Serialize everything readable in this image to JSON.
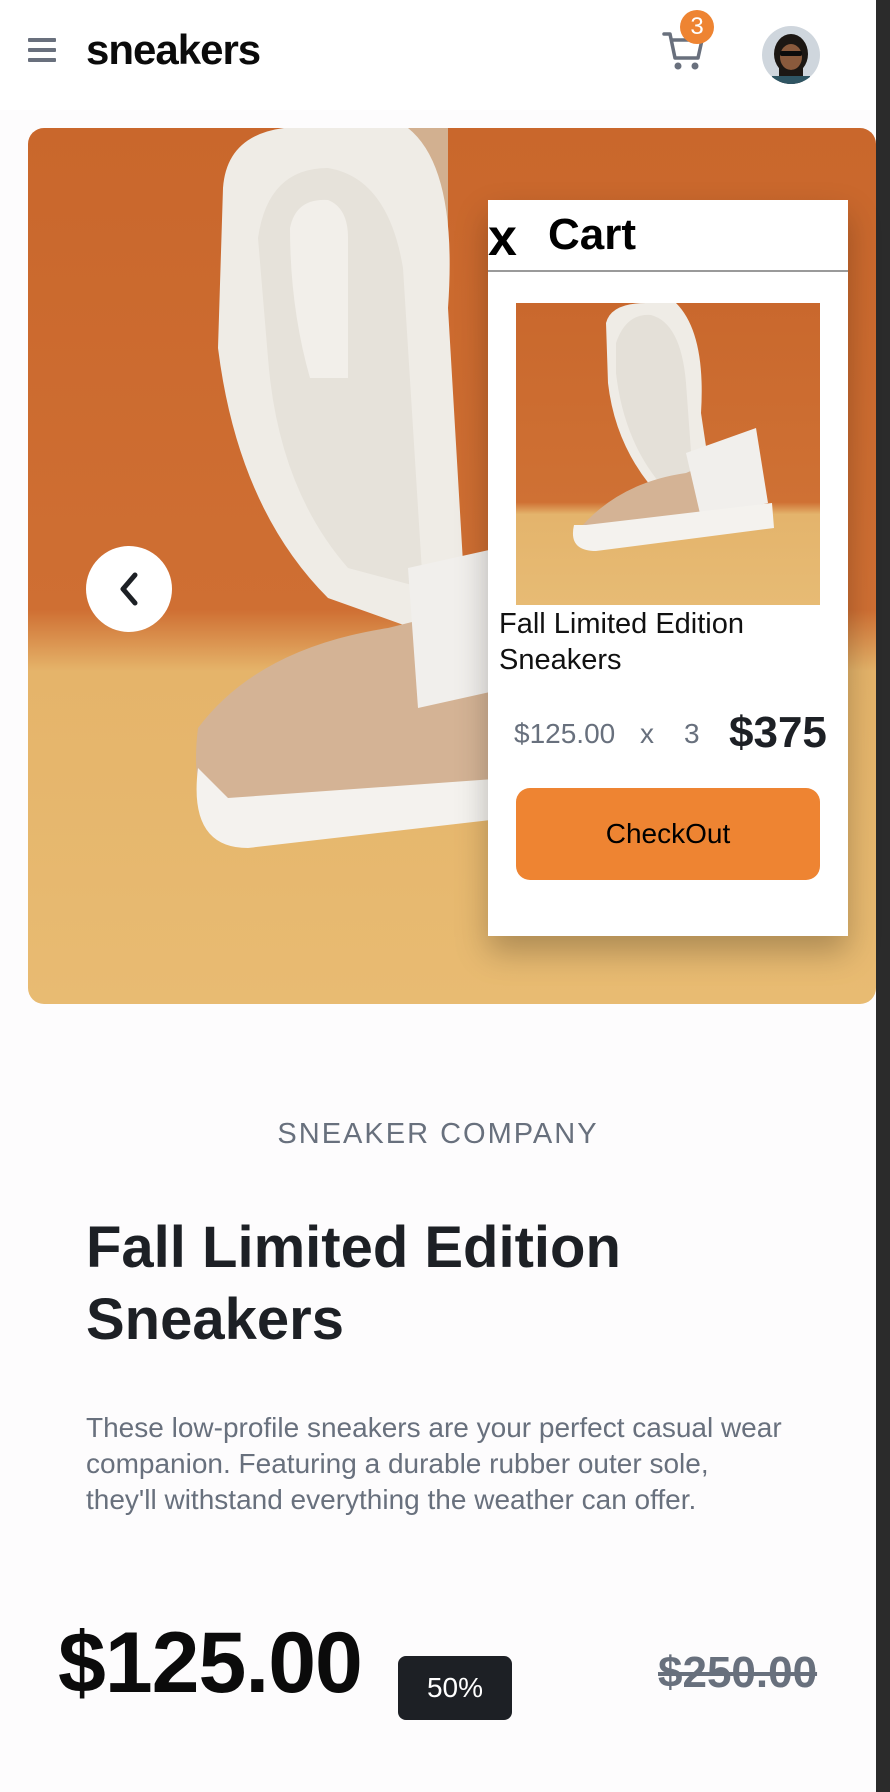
{
  "header": {
    "logo": "sneakers",
    "cart_count": "3"
  },
  "cart": {
    "title": "Cart",
    "close_label": "x",
    "item": {
      "name": "Fall Limited Edition Sneakers",
      "unit_price": "$125.00",
      "multiply": "x",
      "quantity": "3",
      "total": "$375"
    },
    "checkout_label": "CheckOut"
  },
  "product": {
    "company": "SNEAKER COMPANY",
    "title": "Fall Limited Edition Sneakers",
    "description": "These low-profile sneakers are your perfect casual wear companion. Featuring a durable rubber outer sole, they'll withstand everything the weather can offer.",
    "price": "$125.00",
    "discount": "50%",
    "old_price": "$250.00"
  },
  "colors": {
    "accent": "#ee8432",
    "dark": "#1d2025",
    "muted": "#68707d"
  },
  "icons": [
    "menu-icon",
    "cart-icon",
    "chevron-left-icon",
    "close-icon"
  ]
}
